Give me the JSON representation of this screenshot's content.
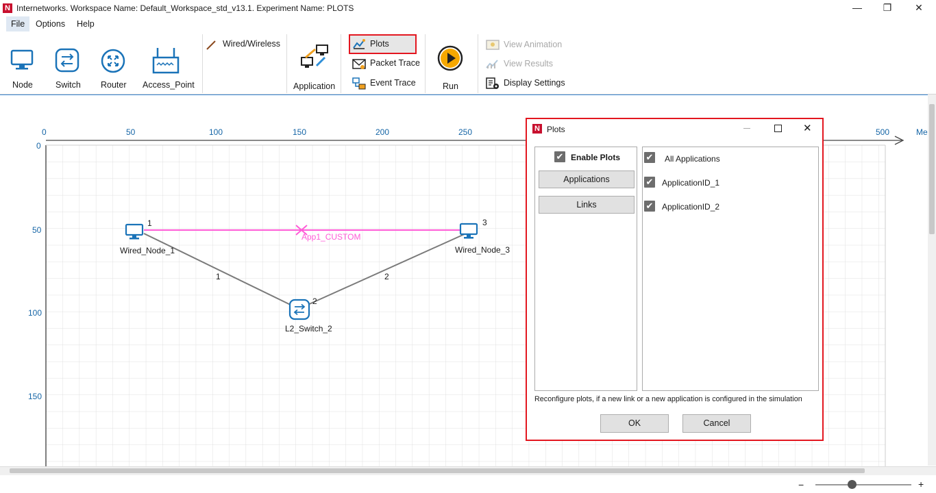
{
  "window": {
    "title": "Internetworks. Workspace Name: Default_Workspace_std_v13.1. Experiment Name: PLOTS",
    "logo": "N",
    "controls": [
      "—",
      "❐",
      "✕"
    ]
  },
  "menu": [
    "File",
    "Options",
    "Help"
  ],
  "ribbon": {
    "devices": [
      "Node",
      "Switch",
      "Router",
      "Access_Point"
    ],
    "wired_wireless": "Wired/Wireless",
    "application": "Application",
    "plots": "Plots",
    "packet_trace": "Packet Trace",
    "event_trace": "Event Trace",
    "run": "Run",
    "view_animation": "View Animation",
    "view_results": "View Results",
    "display_settings": "Display Settings"
  },
  "canvas": {
    "x_ticks": [
      "0",
      "50",
      "100",
      "150",
      "200",
      "250",
      "500"
    ],
    "x_unit_partial": "Me",
    "y_ticks": [
      "0",
      "50",
      "100",
      "150"
    ],
    "nodes": {
      "wired_node_1": {
        "label": "Wired_Node_1",
        "port": "1"
      },
      "wired_node_3": {
        "label": "Wired_Node_3",
        "port": "3"
      },
      "switch": {
        "label": "L2_Switch_2",
        "port": "2"
      }
    },
    "links": {
      "link1": "1",
      "link2": "2"
    },
    "app_label": "App1_CUSTOM",
    "app_color": "#ff5bd7"
  },
  "dialog": {
    "title": "Plots",
    "enable_plots": "Enable Plots",
    "applications_btn": "Applications",
    "links_btn": "Links",
    "items": [
      "All Applications",
      "ApplicationID_1",
      "ApplicationID_2"
    ],
    "note": "Reconfigure plots, if a new link or a new application is configured in the simulation",
    "ok": "OK",
    "cancel": "Cancel"
  },
  "status": {
    "zoom_minus": "−",
    "zoom_plus": "+"
  },
  "colors": {
    "accent": "#1a73b8",
    "highlight": "#e3161f",
    "axis_text": "#1565a6"
  }
}
